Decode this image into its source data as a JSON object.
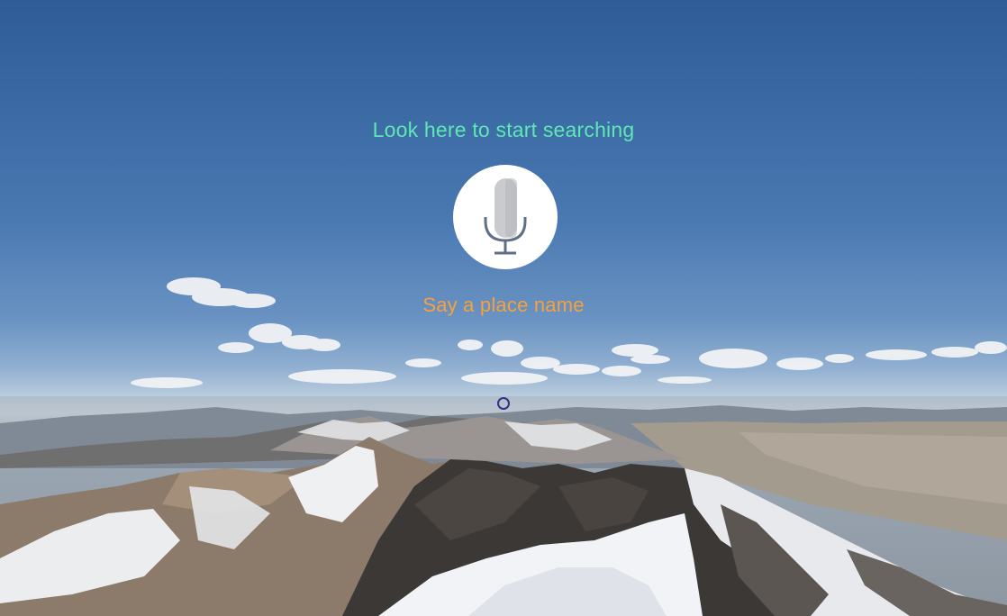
{
  "search_prompt": "Look here to start searching",
  "voice_hint": "Say a place name",
  "mic": {
    "icon": "microphone-icon"
  },
  "colors": {
    "prompt_text": "#5ee8b4",
    "hint_text": "#f7a13c",
    "mic_background": "#ffffff",
    "reticle": "#33308a"
  }
}
